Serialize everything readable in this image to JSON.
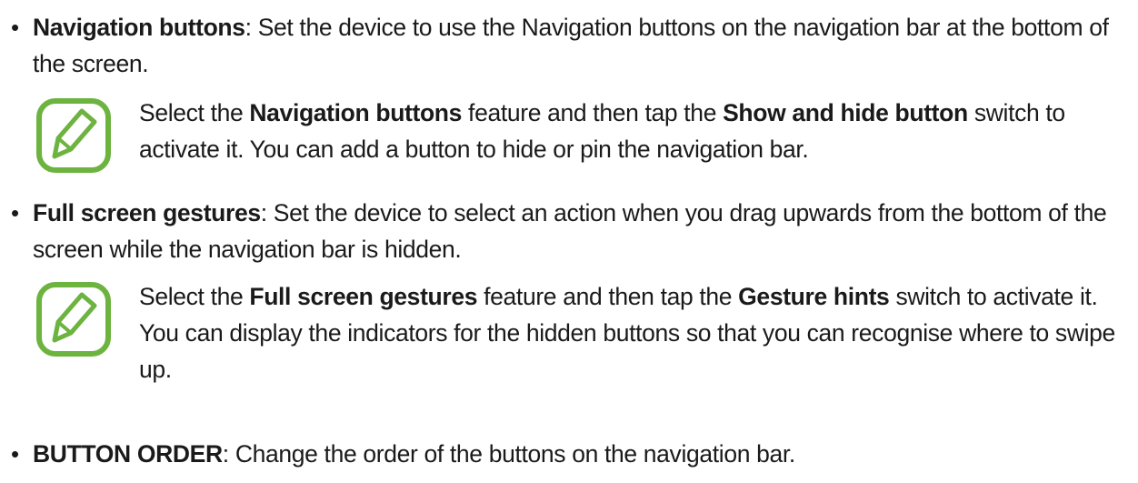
{
  "items": [
    {
      "bullet": "•",
      "term": "Navigation buttons",
      "description": ": Set the device to use the Navigation buttons on the navigation bar at the bottom of the screen.",
      "note": {
        "icon": "note-pencil-icon",
        "parts": [
          "Select the ",
          "Navigation buttons",
          " feature and then tap the ",
          "Show and hide button",
          " switch to activate it. You can add a button to hide or pin the navigation bar."
        ]
      }
    },
    {
      "bullet": "•",
      "term": "Full screen gestures",
      "description": ": Set the device to select an action when you drag upwards from the bottom of the screen while the navigation bar is hidden.",
      "note": {
        "icon": "note-pencil-icon",
        "parts": [
          "Select the ",
          "Full screen gestures",
          " feature and then tap the ",
          "Gesture hints",
          " switch to activate it. You can display the indicators for the hidden buttons so that you can recognise where to swipe up."
        ]
      }
    },
    {
      "bullet": "•",
      "term": "BUTTON ORDER",
      "description": ": Change the order of the buttons on the navigation bar."
    }
  ],
  "colors": {
    "text": "#1a1a1a",
    "icon_green": "#6cb33f"
  }
}
